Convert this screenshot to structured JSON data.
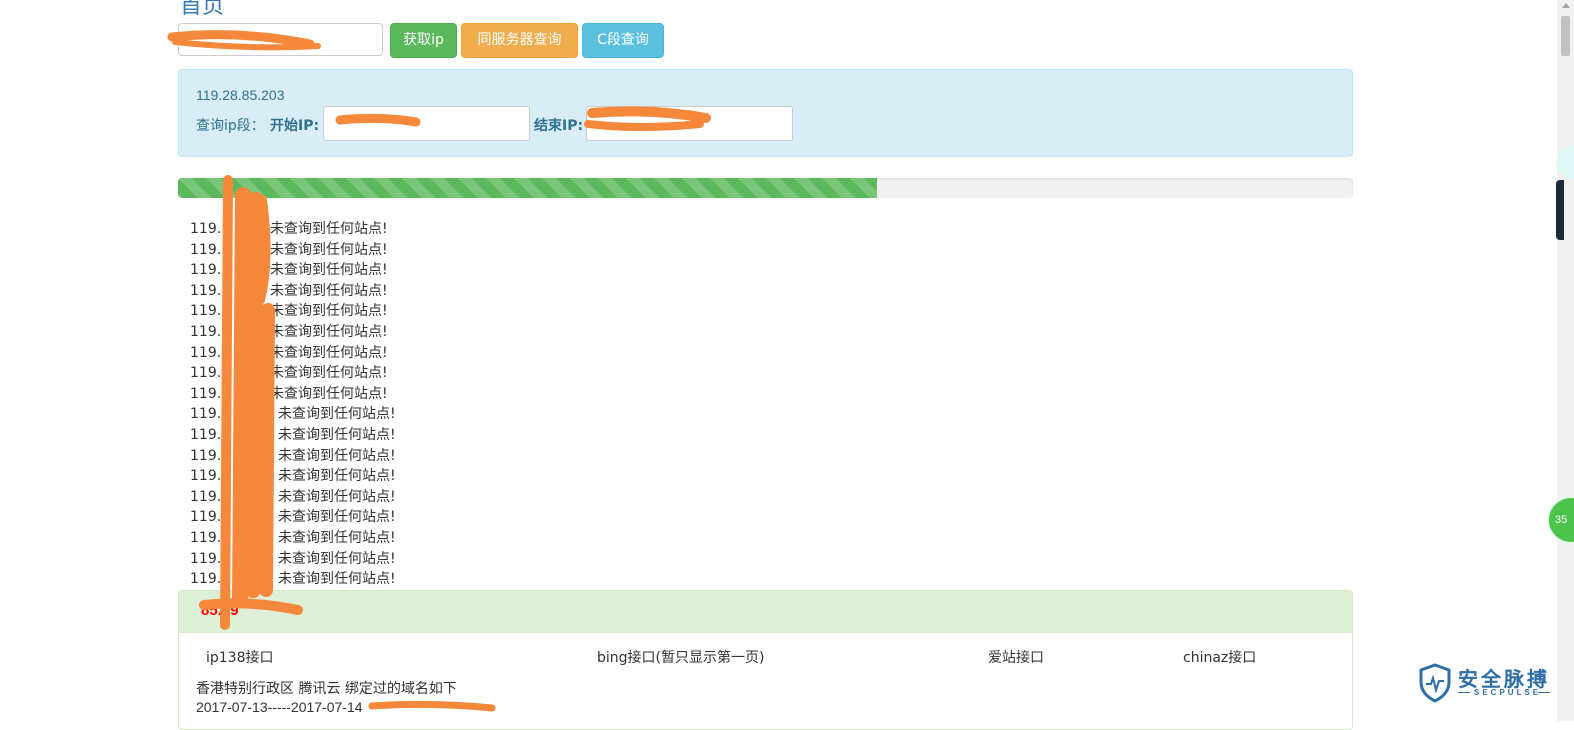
{
  "page": {
    "title": "首页"
  },
  "query": {
    "domain_input_value": "",
    "get_ip_button": "获取ip",
    "same_server_button": "同服务器查询",
    "c_segment_button": "C段查询"
  },
  "info": {
    "resolved_ip": "119.28.85.203",
    "segment_label": "查询ip段：",
    "start_ip_label": "开始IP:",
    "start_ip_value": "",
    "end_ip_label": "结束IP:",
    "end_ip_value": ""
  },
  "progress": {
    "percent": 59.5
  },
  "results": {
    "message": "未查询到任何站点!",
    "lines": [
      {
        "ip": "119."
      },
      {
        "ip": "119."
      },
      {
        "ip": "119."
      },
      {
        "ip": "119."
      },
      {
        "ip": "119."
      },
      {
        "ip": "119."
      },
      {
        "ip": "119."
      },
      {
        "ip": "119."
      },
      {
        "ip": "119."
      },
      {
        "ip": "119."
      },
      {
        "ip": "119."
      },
      {
        "ip": "119."
      },
      {
        "ip": "119."
      },
      {
        "ip": "119."
      },
      {
        "ip": "119."
      },
      {
        "ip": "119."
      },
      {
        "ip": "119.2"
      },
      {
        "ip": "119.2"
      }
    ]
  },
  "panel": {
    "title": "85.49",
    "interfaces": {
      "ip138": "ip138接口",
      "bing": "bing接口(暂只显示第一页)",
      "aizhan": "爱站接口",
      "chinaz": "chinaz接口"
    },
    "region_text": "香港特别行政区 腾讯云 绑定过的域名如下",
    "date_range": "2017-07-13-----2017-07-14"
  },
  "side_widget": {
    "badge_text": "35"
  },
  "watermark": {
    "cn": "安全脉搏",
    "en": "SECPULSE"
  },
  "colors": {
    "primary": "#337ab7",
    "success": "#5cb85c",
    "warning": "#f0ad4e",
    "info": "#5bc0de",
    "redaction": "#f5883a",
    "panel_title": "#ff0000"
  }
}
